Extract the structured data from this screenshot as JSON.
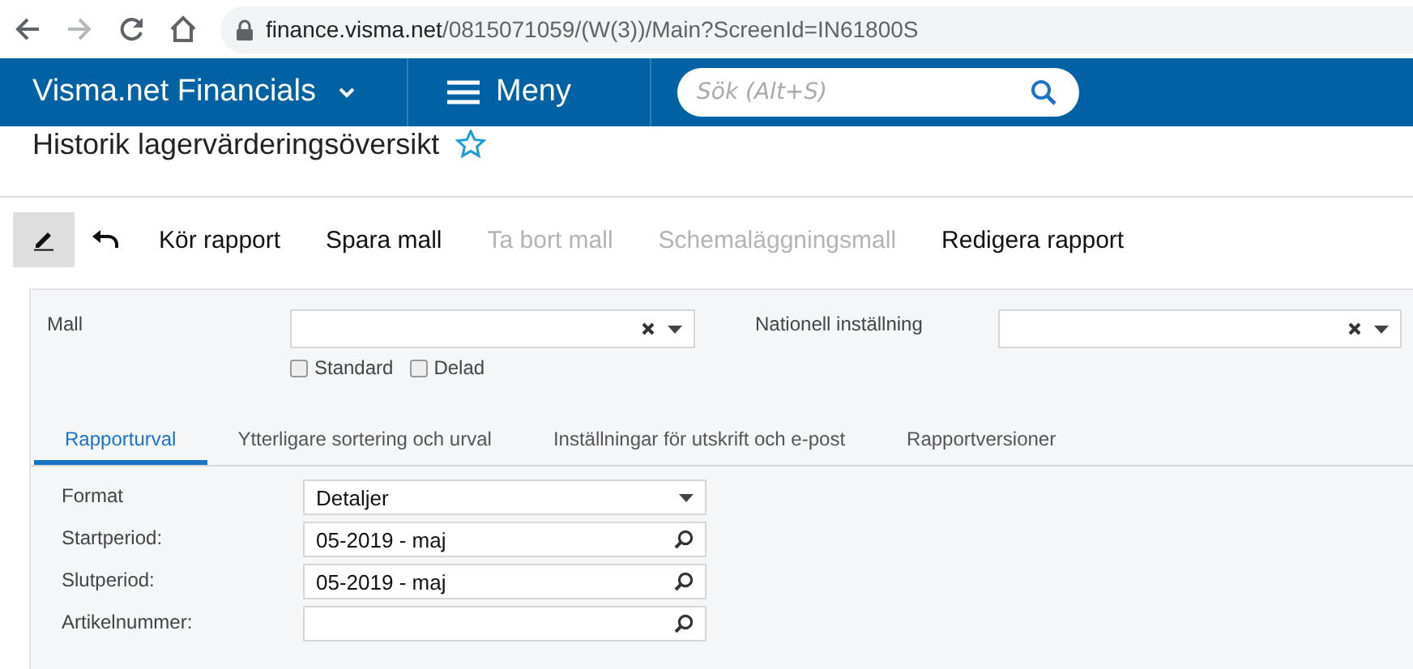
{
  "browser": {
    "url_host": "finance.visma.net",
    "url_path": "/0815071059/(W(3))/Main?ScreenId=IN61800S"
  },
  "header": {
    "app_name": "Visma.net Financials",
    "menu_label": "Meny",
    "search": {
      "placeholder": "Sök (Alt+S)"
    }
  },
  "page": {
    "title": "Historik lagervärderingsöversikt",
    "favorite": false
  },
  "toolbar": [
    {
      "kind": "icon-edit",
      "selected": true,
      "disabled": false
    },
    {
      "kind": "icon-undo",
      "selected": false,
      "disabled": false
    },
    {
      "kind": "text",
      "label": "Kör rapport",
      "selected": false,
      "disabled": false
    },
    {
      "kind": "text",
      "label": "Spara mall",
      "selected": false,
      "disabled": false
    },
    {
      "kind": "text",
      "label": "Ta bort mall",
      "selected": false,
      "disabled": true
    },
    {
      "kind": "text",
      "label": "Schemaläggningsmall",
      "selected": false,
      "disabled": true
    },
    {
      "kind": "text",
      "label": "Redigera rapport",
      "selected": false,
      "disabled": false
    }
  ],
  "template": {
    "mall_label": "Mall",
    "national_label": "Nationell inställning",
    "checkboxes": [
      {
        "label": "Standard",
        "checked": false
      },
      {
        "label": "Delad",
        "checked": false
      }
    ]
  },
  "tabs": [
    {
      "label": "Rapporturval",
      "selected": true
    },
    {
      "label": "Ytterligare sortering och urval",
      "selected": false
    },
    {
      "label": "Inställningar för utskrift och e-post",
      "selected": false
    },
    {
      "label": "Rapportversioner",
      "selected": false
    }
  ],
  "form": [
    {
      "label": "Format",
      "kind": "dropdown",
      "value": "Detaljer"
    },
    {
      "label": "Startperiod:",
      "kind": "lookup",
      "value": "05-2019 - maj"
    },
    {
      "label": "Slutperiod:",
      "kind": "lookup",
      "value": "05-2019 - maj"
    },
    {
      "label": "Artikelnummer:",
      "kind": "lookup"
    }
  ]
}
